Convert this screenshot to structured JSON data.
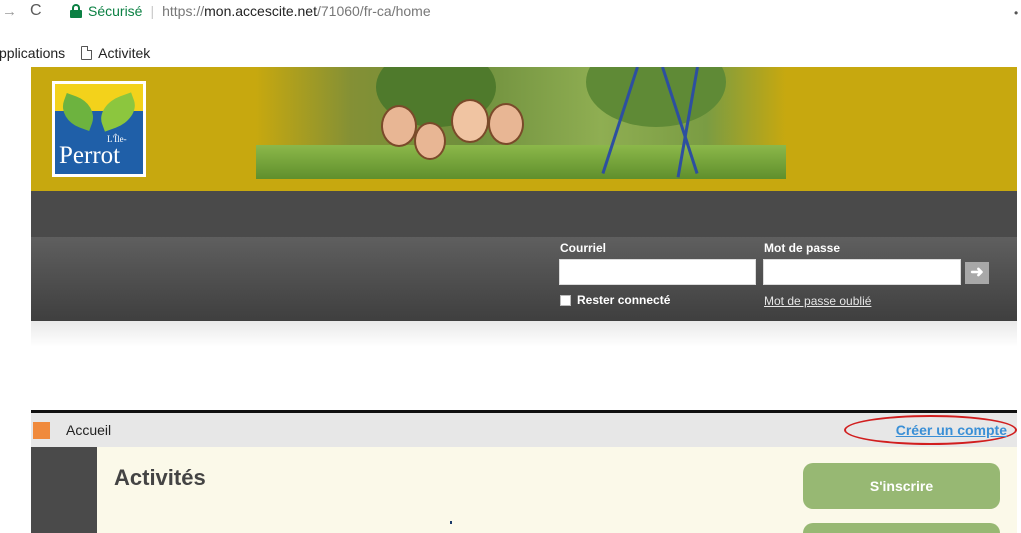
{
  "browser": {
    "secure_label": "Sécurisé",
    "url_prefix": "https://",
    "url_domain": "mon.accescite.net",
    "url_path": "/71060/fr-ca/home",
    "bookmarks": [
      {
        "label": "pplications"
      },
      {
        "label": "Activitek"
      }
    ]
  },
  "site": {
    "logo": {
      "small_text": "L'Île-",
      "name": "Perrot"
    },
    "login": {
      "email_label": "Courriel",
      "password_label": "Mot de passe",
      "remember_label": "Rester connecté",
      "forgot_label": "Mot de passe oublié"
    }
  },
  "content": {
    "breadcrumb": "Accueil",
    "create_account": "Créer un compte",
    "section_title": "Activités",
    "register_button": "S'inscrire"
  },
  "colors": {
    "banner": "#c7a80f",
    "accent_green": "#97b873",
    "link_blue": "#3a8fd6",
    "highlight_red": "#d11e1e"
  }
}
